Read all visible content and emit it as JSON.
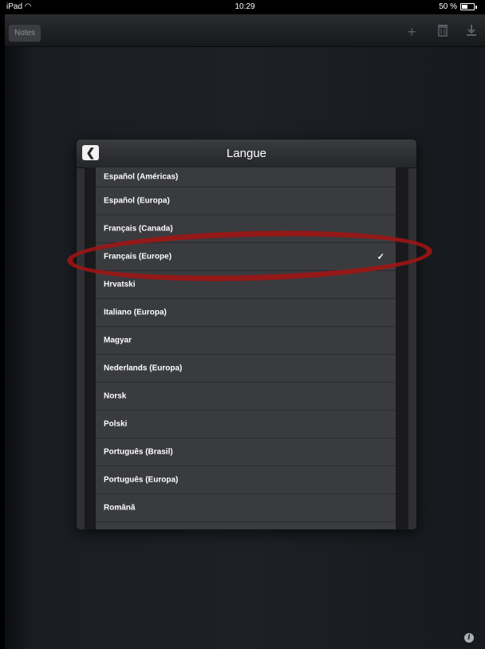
{
  "status_bar": {
    "device": "iPad",
    "time": "10:29",
    "battery": "50 %"
  },
  "toolbar": {
    "notes_label": "Notes",
    "icons": [
      "plus-icon",
      "trash-icon",
      "download-icon"
    ]
  },
  "dialog": {
    "title": "Langue",
    "languages": [
      "Español (Américas)",
      "Español (Europa)",
      "Français (Canada)",
      "Français (Europe)",
      "Hrvatski",
      "Italiano (Europa)",
      "Magyar",
      "Nederlands (Europa)",
      "Norsk",
      "Polski",
      "Português (Brasil)",
      "Português (Europa)",
      "Română"
    ],
    "selected": "Français (Europe)",
    "checkmark": "✓"
  },
  "colors": {
    "annotation_oval": "#a01414",
    "row_background": "#3a3b3e"
  }
}
